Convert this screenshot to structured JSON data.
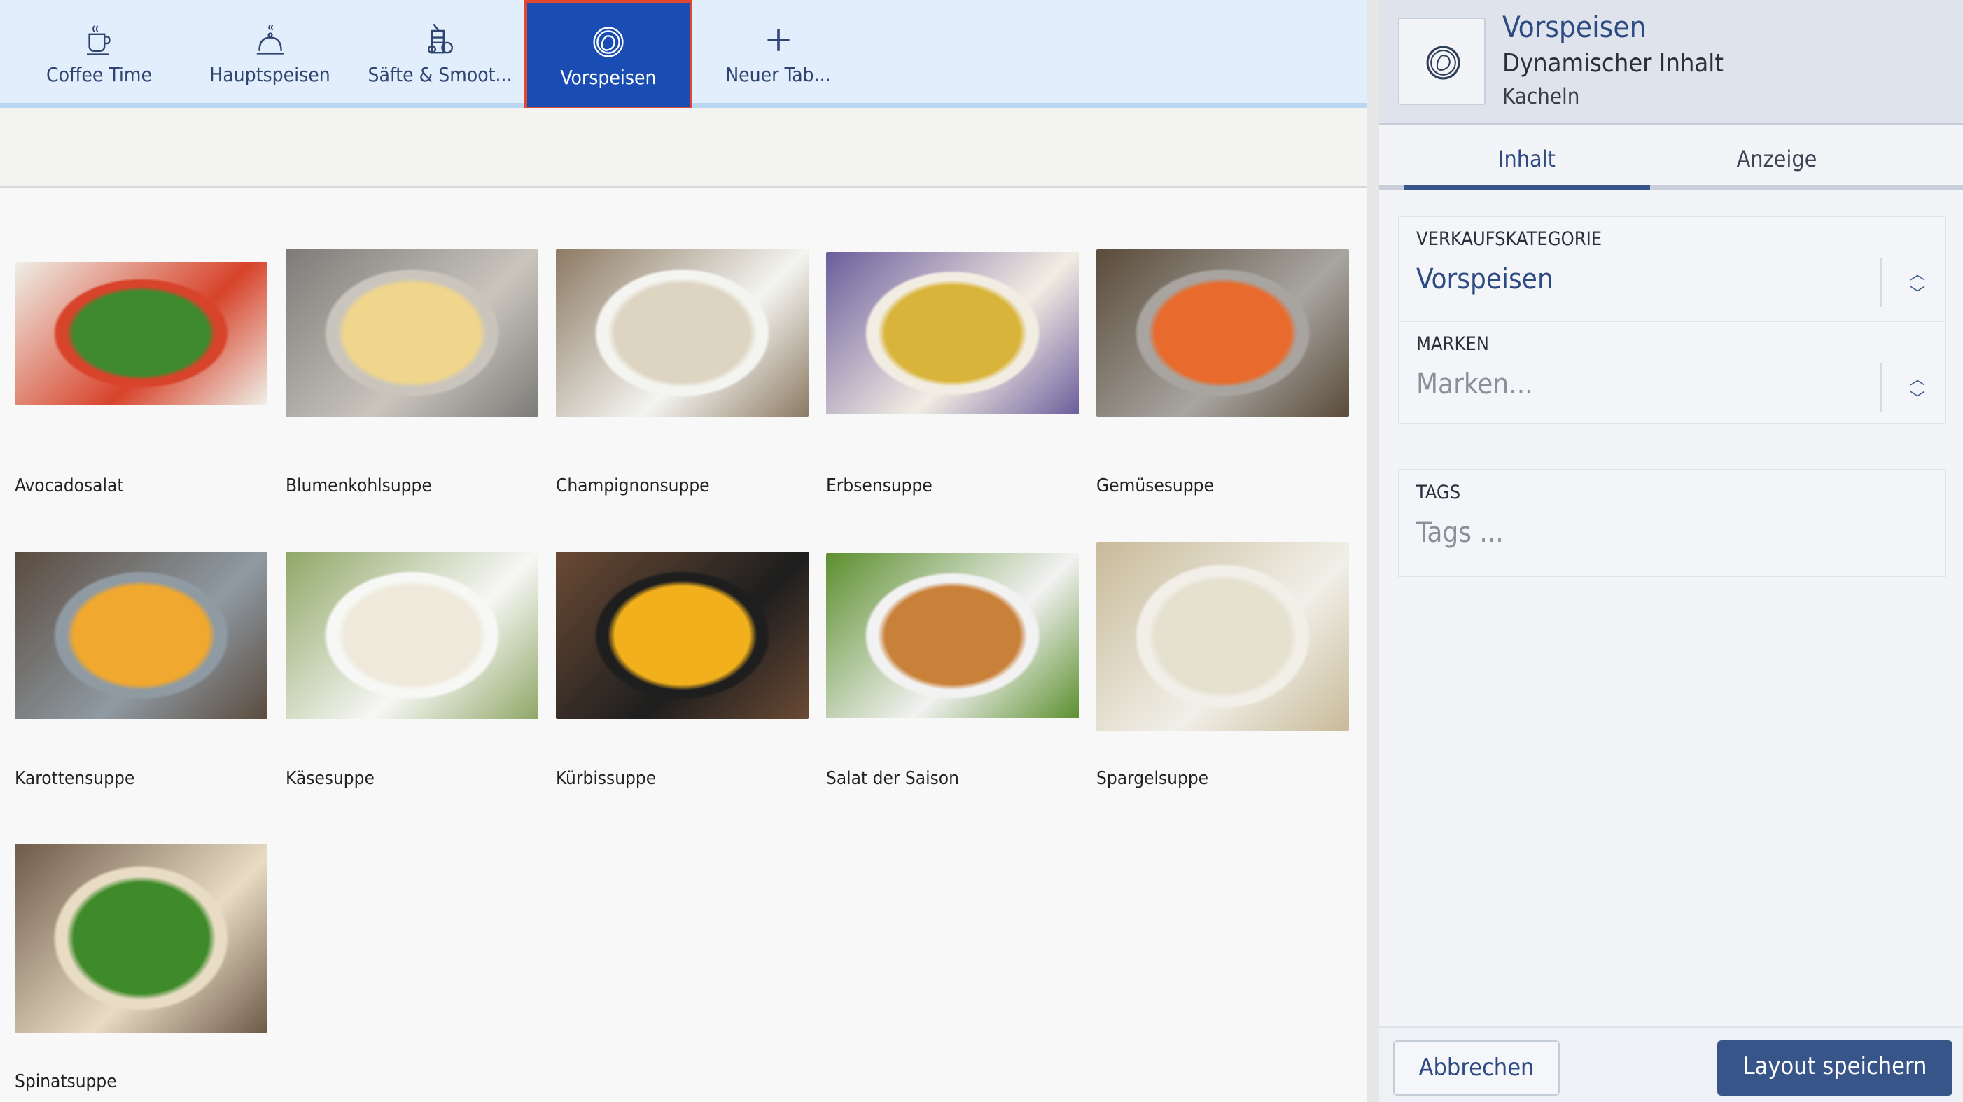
{
  "tabs": [
    {
      "label": "Coffee Time",
      "icon": "coffee-cup-icon"
    },
    {
      "label": "Hauptspeisen",
      "icon": "cloche-icon"
    },
    {
      "label": "Säfte & Smoot...",
      "icon": "juice-glass-icon"
    },
    {
      "label": "Vorspeisen",
      "icon": "salad-plate-icon",
      "active": true
    },
    {
      "label": "Neuer Tab...",
      "icon": "plus-icon"
    }
  ],
  "products": [
    {
      "name": "Avocadosalat",
      "colors": [
        "#3f8a2e",
        "#d8432b",
        "#eef0e8"
      ]
    },
    {
      "name": "Blumenkohlsuppe",
      "colors": [
        "#f0d58c",
        "#c9c5bd",
        "#7d7b78"
      ]
    },
    {
      "name": "Champignonsuppe",
      "colors": [
        "#ddd5c2",
        "#f4f4f0",
        "#8c7a63"
      ]
    },
    {
      "name": "Erbsensuppe",
      "colors": [
        "#d9b43a",
        "#f2ede3",
        "#6b5d9b"
      ]
    },
    {
      "name": "Gemüsesuppe",
      "colors": [
        "#e86a2c",
        "#a8a5a0",
        "#5a4b3a"
      ]
    },
    {
      "name": "Karottensuppe",
      "colors": [
        "#f0a82e",
        "#8f9aa3",
        "#5a4b3e"
      ]
    },
    {
      "name": "Käsesuppe",
      "colors": [
        "#eee9da",
        "#f7f7f5",
        "#8fa766"
      ]
    },
    {
      "name": "Kürbissuppe",
      "colors": [
        "#f2b11c",
        "#1e1e1e",
        "#6a4a34"
      ]
    },
    {
      "name": "Salat der Saison",
      "colors": [
        "#c9813a",
        "#f2f2f2",
        "#5c8f2e"
      ]
    },
    {
      "name": "Spargelsuppe",
      "colors": [
        "#e4e1cf",
        "#f1efe8",
        "#c8ba99"
      ]
    },
    {
      "name": "Spinatsuppe",
      "colors": [
        "#3f8a2a",
        "#e8dcc4",
        "#6d5a48"
      ]
    }
  ],
  "panel": {
    "title": "Vorspeisen",
    "subtitle": "Dynamischer Inhalt",
    "type": "Kacheln",
    "icon": "salad-plate-icon",
    "tabs": [
      "Inhalt",
      "Anzeige"
    ],
    "active_tab": "Inhalt",
    "sales_category_label": "VERKAUFSKATEGORIE",
    "sales_category_value": "Vorspeisen",
    "brands_label": "MARKEN",
    "brands_placeholder": "Marken...",
    "tags_label": "TAGS",
    "tags_placeholder": "Tags ..."
  },
  "footer": {
    "cancel": "Abbrechen",
    "save": "Layout speichern"
  },
  "colors": {
    "accent": "#1a4db3",
    "primary_button": "#38558a",
    "active_outline": "#e2462f"
  }
}
